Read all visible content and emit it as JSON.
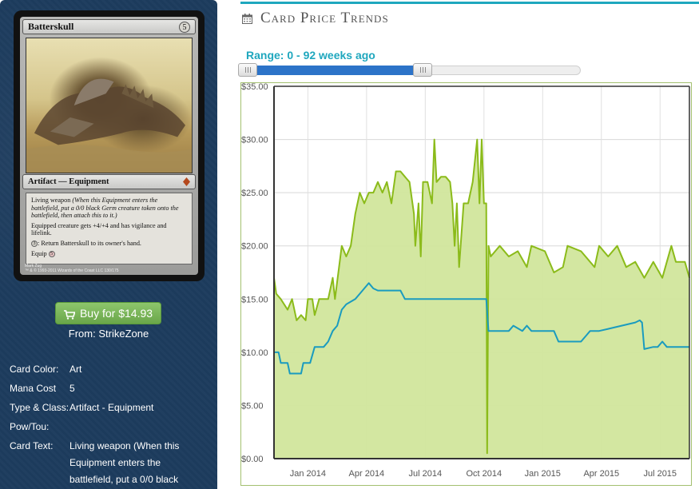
{
  "card": {
    "name": "Batterskull",
    "mana_symbol": "5",
    "type_line": "Artifact — Equipment",
    "rules": [
      {
        "normal": "Living weapon ",
        "italic": "(When this Equipment enters the battlefield, put a 0/0 black Germ creature token onto the battlefield, then attach this to it.)"
      },
      {
        "normal": "Equipped creature gets +4/+4 and has vigilance and lifelink.",
        "italic": ""
      },
      {
        "symbol": "3",
        "normal": ": Return Batterskull to its owner's hand.",
        "italic": ""
      },
      {
        "normal": "Equip ",
        "symbol_after": "5",
        "italic": ""
      }
    ],
    "artist": "Mark Zug",
    "copyright": "™ & © 1993-2011 Wizards of the Coast LLC 130/175"
  },
  "buy": {
    "label": "Buy for $14.93",
    "icon": "shopping-cart-icon"
  },
  "from": "From: StrikeZone",
  "info": {
    "card_color_label": "Card Color:",
    "card_color": "Art",
    "mana_cost_label": "Mana Cost",
    "mana_cost": "5",
    "type_label": "Type & Class:",
    "type": "Artifact - Equipment",
    "pow_label": "Pow/Tou:",
    "pow": "",
    "text_label": "Card Text:",
    "text_lines": [
      "Living weapon (When this",
      "Equipment enters the",
      "battlefield, put a 0/0 black"
    ]
  },
  "section": {
    "title": "Card Price Trends",
    "icon": "calendar-icon"
  },
  "range": {
    "label": "Range: 0 - 92 weeks ago",
    "start_weeks": 0,
    "end_weeks": 92
  },
  "colors": {
    "accent": "#1fa7be",
    "green_line": "#8bbb1a",
    "green_fill": "#d1e69c",
    "blue_line": "#1a9bbf",
    "panel": "#1d3c5e",
    "buy": "#78b457"
  },
  "chart_data": {
    "type": "line",
    "ylim": [
      0,
      35
    ],
    "y_ticks": [
      "$0.00",
      "$5.00",
      "$10.00",
      "$15.00",
      "$20.00",
      "$25.00",
      "$30.00",
      "$35.00"
    ],
    "x_ticks": [
      "Jan 2014",
      "Apr 2014",
      "Jul 2014",
      "Oct 2014",
      "Jan 2015",
      "Apr 2015",
      "Jul 2015"
    ],
    "x_tick_weeks": [
      7.5,
      20.5,
      33.5,
      46.5,
      59.5,
      72.5,
      85.5
    ],
    "x_range_weeks": [
      0,
      92
    ],
    "series": [
      {
        "color": "#8bbb1a",
        "fill": true,
        "points": [
          [
            0,
            17
          ],
          [
            0.5,
            15.5
          ],
          [
            1.5,
            15
          ],
          [
            3,
            14
          ],
          [
            4,
            15
          ],
          [
            5,
            13
          ],
          [
            6,
            13.5
          ],
          [
            7,
            13
          ],
          [
            7.5,
            15
          ],
          [
            8.5,
            15
          ],
          [
            9,
            13.5
          ],
          [
            10,
            15
          ],
          [
            12,
            15
          ],
          [
            13,
            17
          ],
          [
            13.5,
            15
          ],
          [
            15,
            20
          ],
          [
            16,
            19
          ],
          [
            17,
            20
          ],
          [
            18,
            23
          ],
          [
            19,
            25
          ],
          [
            20,
            24
          ],
          [
            21,
            25
          ],
          [
            22,
            25
          ],
          [
            23,
            26
          ],
          [
            24,
            25
          ],
          [
            25,
            26
          ],
          [
            26,
            24
          ],
          [
            27,
            27
          ],
          [
            28,
            27
          ],
          [
            29,
            26.5
          ],
          [
            30,
            26
          ],
          [
            31,
            23
          ],
          [
            31.3,
            20
          ],
          [
            32,
            24
          ],
          [
            32.5,
            19
          ],
          [
            33,
            26
          ],
          [
            34,
            26
          ],
          [
            35,
            24
          ],
          [
            35.5,
            30
          ],
          [
            36,
            26
          ],
          [
            37,
            26.5
          ],
          [
            38,
            26.5
          ],
          [
            39,
            26
          ],
          [
            39.5,
            24
          ],
          [
            40,
            20
          ],
          [
            40.5,
            24
          ],
          [
            41,
            18
          ],
          [
            42,
            24
          ],
          [
            43,
            24
          ],
          [
            44,
            26
          ],
          [
            45,
            30
          ],
          [
            45.5,
            24
          ],
          [
            46,
            30
          ],
          [
            46.5,
            24
          ],
          [
            47,
            24
          ],
          [
            47.2,
            0.5
          ],
          [
            47.5,
            20
          ],
          [
            48,
            19
          ],
          [
            50,
            20
          ],
          [
            52,
            19
          ],
          [
            54,
            19.5
          ],
          [
            56,
            18
          ],
          [
            57,
            20
          ],
          [
            60,
            19.5
          ],
          [
            62,
            17.5
          ],
          [
            64,
            18
          ],
          [
            65,
            20
          ],
          [
            68,
            19.5
          ],
          [
            71,
            18
          ],
          [
            72,
            20
          ],
          [
            74,
            19
          ],
          [
            76,
            20
          ],
          [
            78,
            18
          ],
          [
            80,
            18.5
          ],
          [
            82,
            17
          ],
          [
            84,
            18.5
          ],
          [
            86,
            17
          ],
          [
            88,
            20
          ],
          [
            89,
            18.5
          ],
          [
            91,
            18.5
          ],
          [
            92,
            17
          ]
        ]
      },
      {
        "color": "#1a9bbf",
        "fill": false,
        "points": [
          [
            0,
            10
          ],
          [
            1,
            10
          ],
          [
            1.5,
            9
          ],
          [
            3,
            9
          ],
          [
            3.5,
            8
          ],
          [
            6,
            8
          ],
          [
            6.5,
            9
          ],
          [
            8,
            9
          ],
          [
            9,
            10.5
          ],
          [
            11,
            10.5
          ],
          [
            12,
            11
          ],
          [
            13,
            12
          ],
          [
            14,
            12.5
          ],
          [
            15,
            14
          ],
          [
            16,
            14.5
          ],
          [
            18,
            15
          ],
          [
            19,
            15.5
          ],
          [
            20,
            16
          ],
          [
            21,
            16.5
          ],
          [
            22,
            16
          ],
          [
            23,
            15.8
          ],
          [
            28,
            15.8
          ],
          [
            29,
            15
          ],
          [
            47,
            15
          ],
          [
            47.5,
            12
          ],
          [
            52,
            12
          ],
          [
            53,
            12.5
          ],
          [
            55,
            12
          ],
          [
            56,
            12.5
          ],
          [
            57,
            12
          ],
          [
            62,
            12
          ],
          [
            63,
            11
          ],
          [
            68,
            11
          ],
          [
            69,
            11.5
          ],
          [
            70,
            12
          ],
          [
            72,
            12
          ],
          [
            74,
            12.2
          ],
          [
            77,
            12.5
          ],
          [
            80,
            12.8
          ],
          [
            81,
            13
          ],
          [
            81.5,
            12.8
          ],
          [
            82,
            10.3
          ],
          [
            84,
            10.5
          ],
          [
            85,
            10.5
          ],
          [
            86,
            11
          ],
          [
            87,
            10.5
          ],
          [
            89,
            10.5
          ],
          [
            90,
            10.5
          ],
          [
            92,
            10.5
          ]
        ]
      }
    ]
  }
}
